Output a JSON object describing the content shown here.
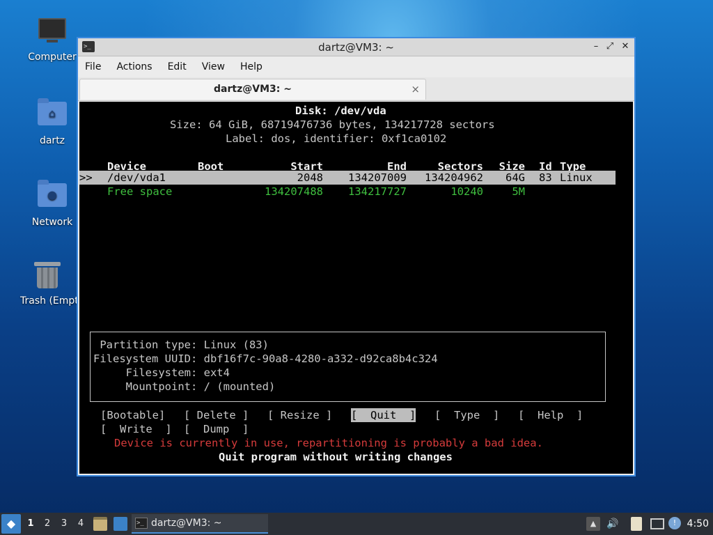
{
  "desktop": {
    "icons": [
      {
        "label": "Computer",
        "icon": "computer-icon"
      },
      {
        "label": "dartz",
        "icon": "home-folder-icon"
      },
      {
        "label": "Network",
        "icon": "network-folder-icon"
      },
      {
        "label": "Trash (Empty)",
        "icon": "trash-icon"
      }
    ]
  },
  "window": {
    "title": "dartz@VM3: ~",
    "menu": [
      "File",
      "Actions",
      "Edit",
      "View",
      "Help"
    ],
    "tab_label": "dartz@VM3: ~",
    "tab_close": "×"
  },
  "terminal": {
    "disk_title": "Disk: /dev/vda",
    "size_line": "Size: 64 GiB, 68719476736 bytes, 134217728 sectors",
    "label_line": "Label: dos, identifier: 0xf1ca0102",
    "headers": {
      "device": "Device",
      "boot": "Boot",
      "start": "Start",
      "end": "End",
      "sectors": "Sectors",
      "size": "Size",
      "id": "Id",
      "type": "Type"
    },
    "rows": [
      {
        "marker": ">>",
        "device": "/dev/vda1",
        "boot": "",
        "start": "2048",
        "end": "134207009",
        "sectors": "134204962",
        "size": "64G",
        "id": "83",
        "type": "Linux"
      },
      {
        "marker": "",
        "device": "Free space",
        "boot": "",
        "start": "134207488",
        "end": "134217727",
        "sectors": "10240",
        "size": "5M",
        "id": "",
        "type": ""
      }
    ],
    "info": [
      " Partition type: Linux (83)",
      "Filesystem UUID: dbf16f7c-90a8-4280-a332-d92ca8b4c324",
      "     Filesystem: ext4",
      "     Mountpoint: / (mounted)"
    ],
    "buttons": [
      "[Bootable]",
      "[ Delete ]",
      "[ Resize ]",
      "[  Quit  ]",
      "[  Type  ]",
      "[  Help  ]",
      "[  Write  ]",
      "[  Dump  ]"
    ],
    "selected_button": "[  Quit  ]",
    "warning": "Device is currently in use, repartitioning is probably a bad idea.",
    "hint": "Quit program without writing changes"
  },
  "taskbar": {
    "workspaces": [
      "1",
      "2",
      "3",
      "4"
    ],
    "active_workspace": "1",
    "task_label": "dartz@VM3: ~",
    "clock": "4:50"
  }
}
